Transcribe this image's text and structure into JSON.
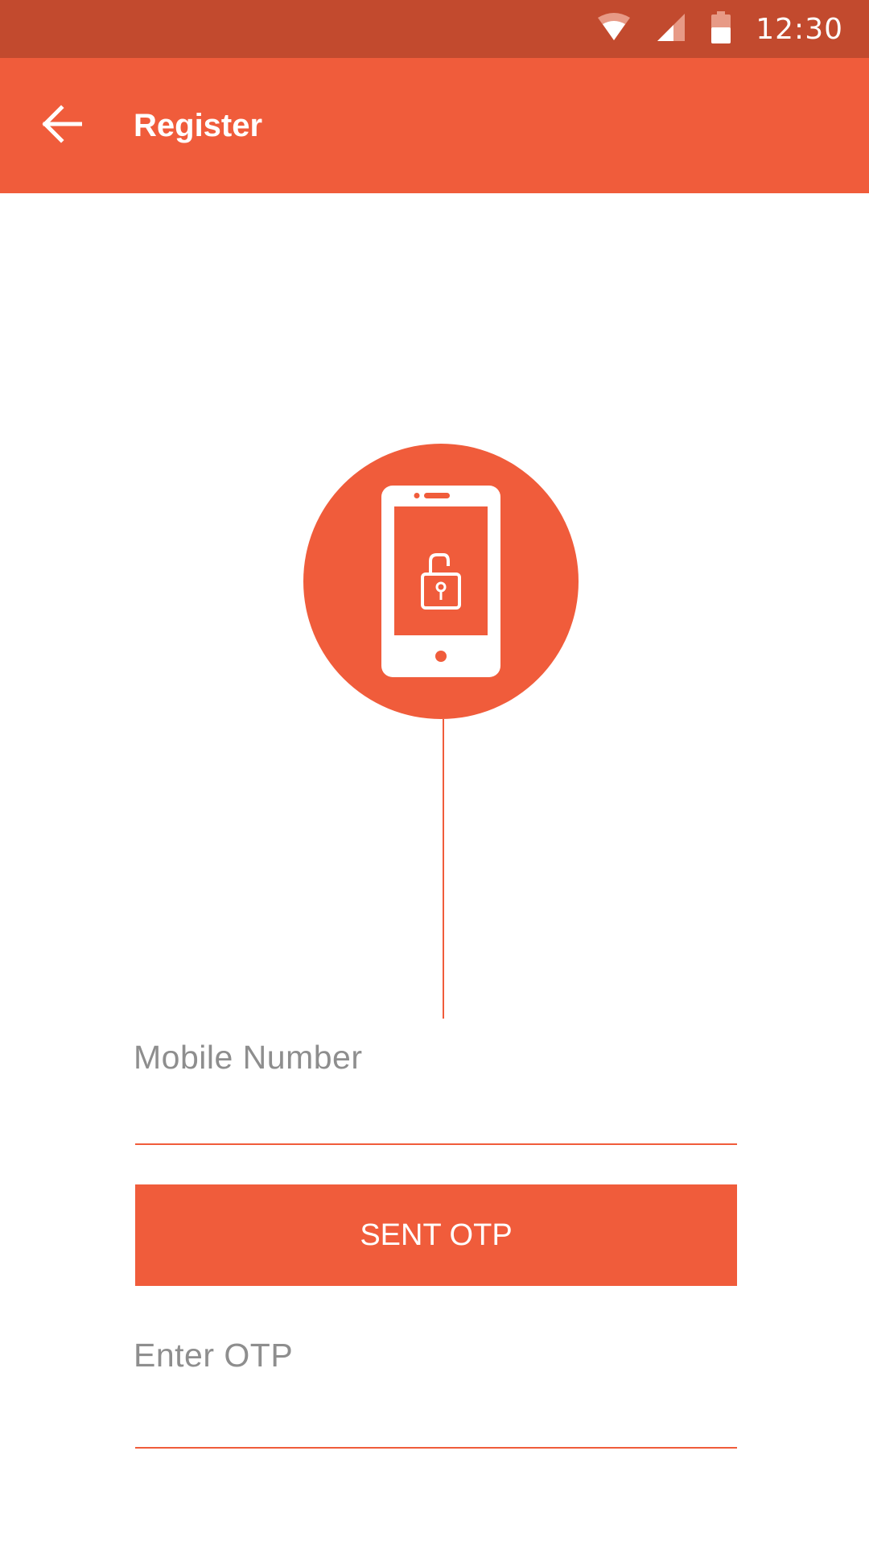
{
  "status_bar": {
    "time": "12:30",
    "icons": [
      "wifi-icon",
      "cellular-signal-icon",
      "battery-icon"
    ],
    "background": "#c24a2e"
  },
  "app_bar": {
    "title": "Register",
    "back_icon": "arrow-back-icon",
    "background": "#f05c3b"
  },
  "hero": {
    "icon": "smartphone-unlock-icon",
    "accent": "#f05c3b"
  },
  "form": {
    "mobile_label": "Mobile Number",
    "mobile_value": "",
    "send_otp_label": "SENT OTP",
    "otp_label": "Enter OTP",
    "otp_value": ""
  },
  "colors": {
    "accent": "#f05c3b",
    "status_bar": "#c24a2e",
    "label_text": "#8e8e8e"
  }
}
